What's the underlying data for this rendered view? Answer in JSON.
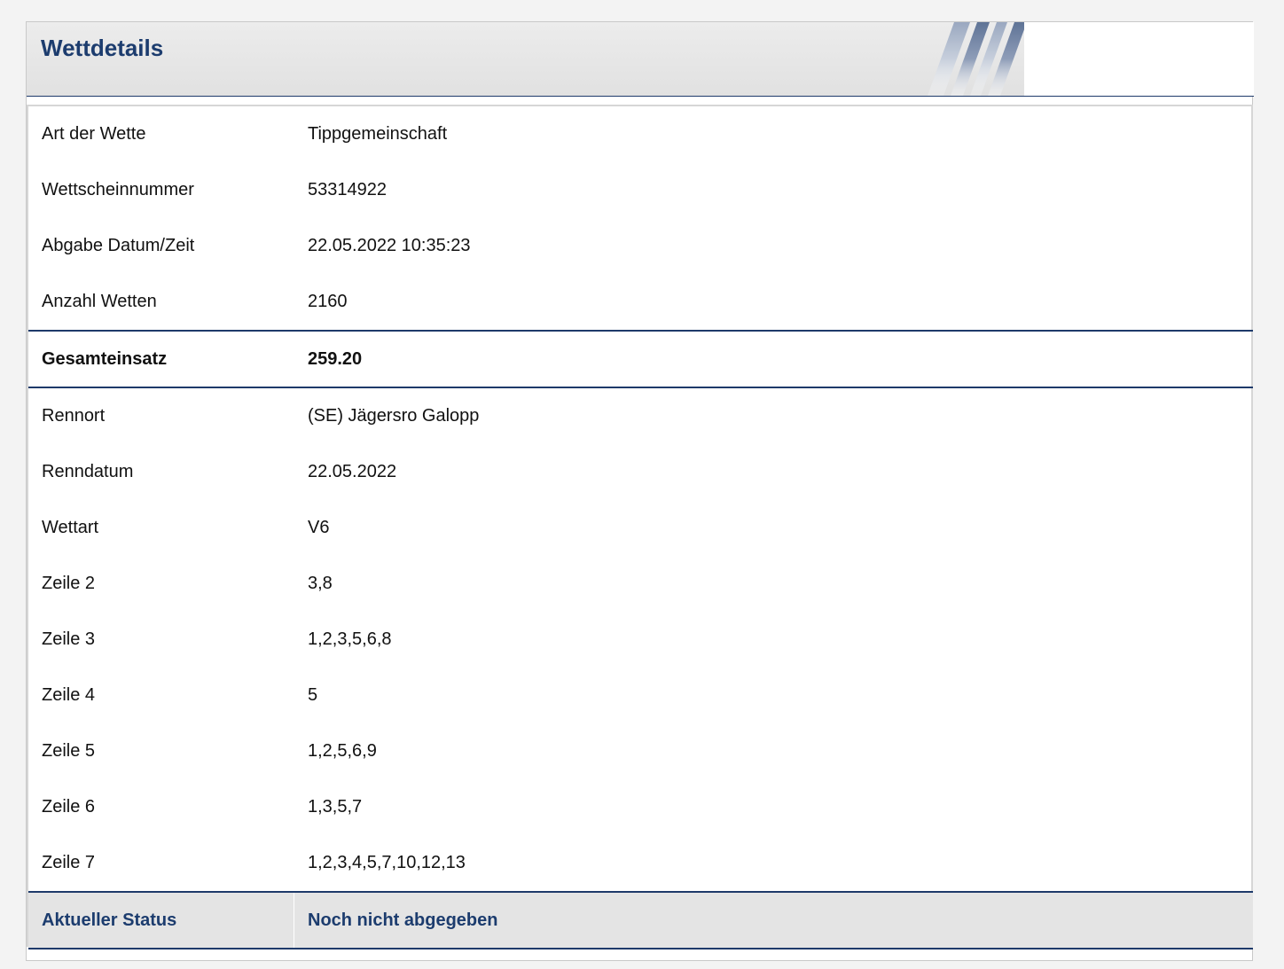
{
  "header": {
    "title": "Wettdetails"
  },
  "details": {
    "rows": [
      {
        "label": "Art der Wette",
        "value": "Tippgemeinschaft"
      },
      {
        "label": "Wettscheinnummer",
        "value": "53314922"
      },
      {
        "label": "Abgabe Datum/Zeit",
        "value": "22.05.2022 10:35:23"
      },
      {
        "label": "Anzahl Wetten",
        "value": "2160"
      }
    ],
    "total": {
      "label": "Gesamteinsatz",
      "value": "259.20"
    },
    "race_rows": [
      {
        "label": "Rennort",
        "value": "(SE) Jägersro Galopp"
      },
      {
        "label": "Renndatum",
        "value": "22.05.2022"
      },
      {
        "label": "Wettart",
        "value": "V6"
      },
      {
        "label": "Zeile 2",
        "value": "3,8"
      },
      {
        "label": "Zeile 3",
        "value": "1,2,3,5,6,8"
      },
      {
        "label": "Zeile 4",
        "value": "5"
      },
      {
        "label": "Zeile 5",
        "value": "1,2,5,6,9"
      },
      {
        "label": "Zeile 6",
        "value": "1,3,5,7"
      },
      {
        "label": "Zeile 7",
        "value": "1,2,3,4,5,7,10,12,13"
      }
    ],
    "status": {
      "label": "Aktueller Status",
      "value": "Noch nicht abgegeben"
    }
  },
  "colors": {
    "accent": "#1c3c6e",
    "header_bg": "#e6e6e6",
    "status_bg": "#e4e4e4"
  }
}
